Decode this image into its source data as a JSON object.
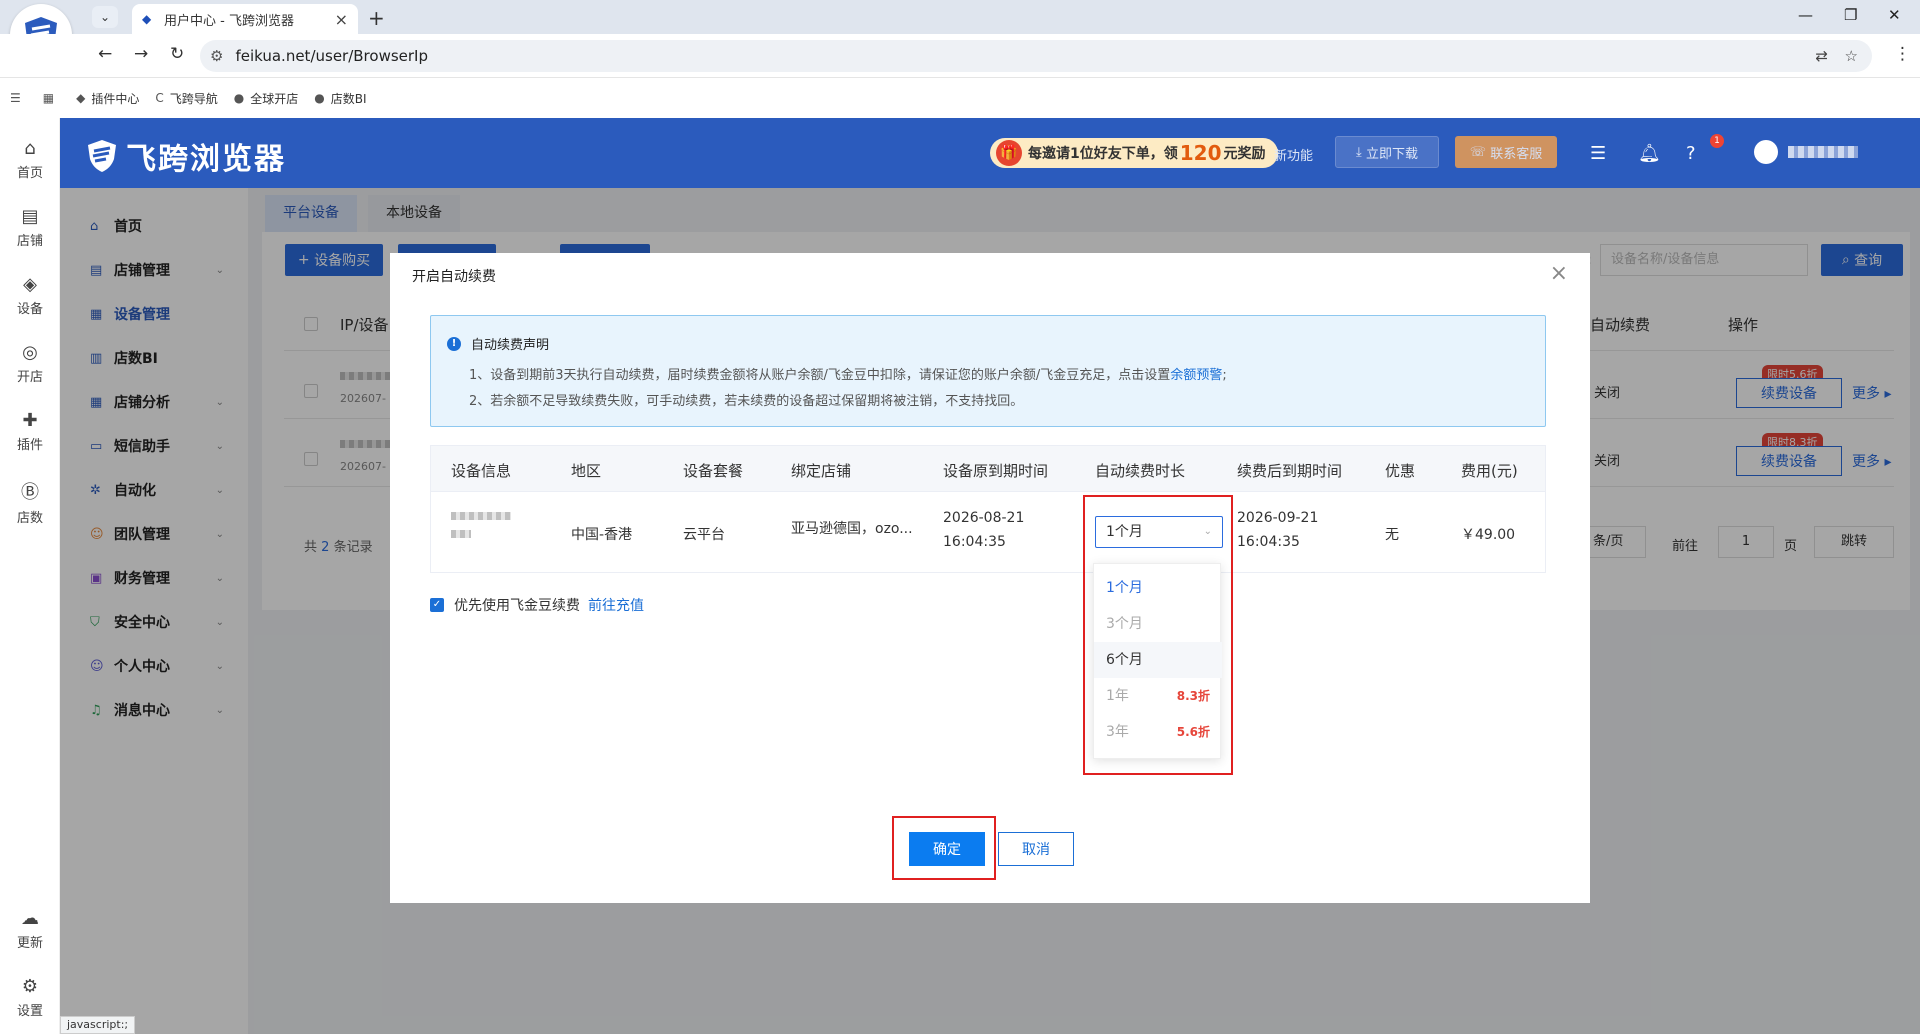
{
  "browser": {
    "tab_title": "用户中心 - 飞跨浏览器",
    "url": "feikua.net/user/BrowserIp",
    "bookmarks": [
      "插件中心",
      "飞跨导航",
      "全球开店",
      "店数BI"
    ],
    "status_text": "javascript:;"
  },
  "rail": [
    "首页",
    "店铺",
    "设备",
    "开店",
    "插件",
    "店数",
    "更新",
    "设置"
  ],
  "header": {
    "brand": "飞跨浏览器",
    "promo_pre": "每邀请1位好友下单，领",
    "promo_amount": "120",
    "promo_post": "元奖励",
    "new_feature": "新功能",
    "download": "立即下载",
    "service": "联系客服",
    "notif_count": "1"
  },
  "sidebar": [
    "首页",
    "店铺管理",
    "设备管理",
    "店数BI",
    "店铺分析",
    "短信助手",
    "自动化",
    "团队管理",
    "财务管理",
    "安全中心",
    "个人中心",
    "消息中心"
  ],
  "content": {
    "tabs": [
      "平台设备",
      "本地设备"
    ],
    "buy_button": "设备购买",
    "search_label": ":",
    "search_placeholder": "设备名称/设备信息",
    "query_button": "查询",
    "col_ip": "IP/设备",
    "col_auto": "自动续费",
    "col_action": "操作",
    "rows": [
      {
        "date": "202607-",
        "auto": "关闭",
        "tag": "限时5.6折",
        "renew": "续费设备",
        "more": "更多"
      },
      {
        "date": "202607-",
        "auto": "关闭",
        "tag": "限时8.3折",
        "renew": "续费设备",
        "more": "更多"
      }
    ],
    "total_pre": "共",
    "total_count": "2",
    "total_post": "条记录",
    "per_page": "条/页",
    "goto": "前往",
    "page": "1",
    "page_unit": "页",
    "jump": "跳转"
  },
  "modal": {
    "title": "开启自动续费",
    "notice_title": "自动续费声明",
    "notice_line1": "1、设备到期前3天执行自动续费，届时续费金额将从账户余额/飞金豆中扣除，请保证您的账户余额/飞金豆充足，点击设置",
    "notice_link": "余额预警",
    "notice_line1_end": ";",
    "notice_line2": "2、若余额不足导致续费失败，可手动续费，若未续费的设备超过保留期将被注销，不支持找回。",
    "headers": [
      "设备信息",
      "地区",
      "设备套餐",
      "绑定店铺",
      "设备原到期时间",
      "自动续费时长",
      "续费后到期时间",
      "优惠",
      "费用(元)"
    ],
    "row": {
      "region": "中国-香港",
      "package": "云平台",
      "store": "亚马逊德国，ozo...",
      "orig_date": "2026-08-21",
      "orig_time": "16:04:35",
      "duration": "1个月",
      "new_date": "2026-09-21",
      "new_time": "16:04:35",
      "discount": "无",
      "fee": "￥49.00"
    },
    "options": [
      {
        "label": "1个月",
        "disc": ""
      },
      {
        "label": "3个月",
        "disc": ""
      },
      {
        "label": "6个月",
        "disc": ""
      },
      {
        "label": "1年",
        "disc": "8.3折"
      },
      {
        "label": "3年",
        "disc": "5.6折"
      }
    ],
    "checkbox_label": "优先使用飞金豆续费",
    "recharge_link": "前往充值",
    "confirm": "确定",
    "cancel": "取消"
  }
}
